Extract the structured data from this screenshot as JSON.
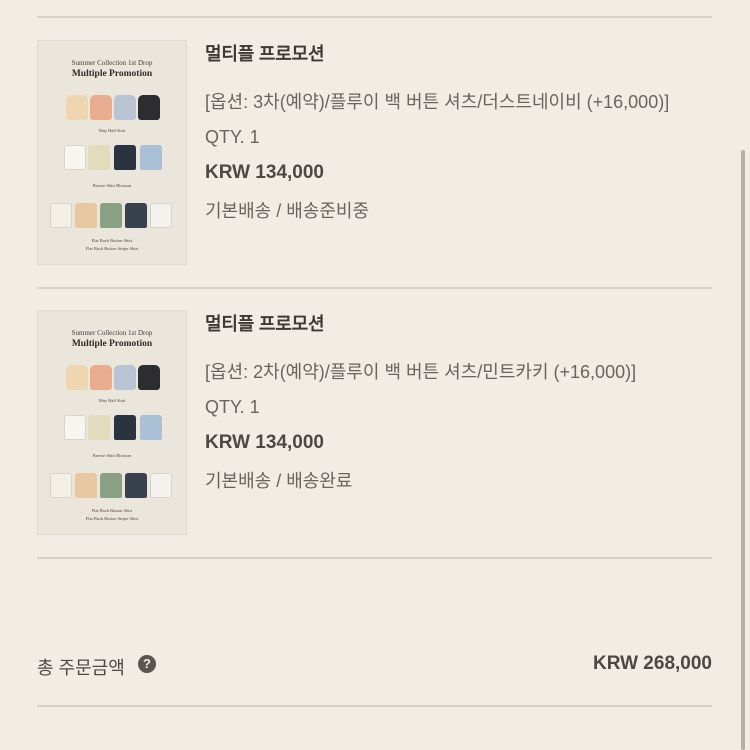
{
  "items": [
    {
      "thumbnail": {
        "subtitle": "Summer Collection 1st Drop",
        "title": "Multiple Promotion",
        "row_labels": [
          "May Half Knit",
          "Breeze Shirt Blouson",
          "Flat Back Button Shirt",
          "Flat Back Button Stripe Shirt"
        ]
      },
      "product_name": "멀티플 프로모션",
      "option": "[옵션: 3차(예약)/플루이 백 버튼 셔츠/더스트네이비 (+16,000)]",
      "qty": "QTY. 1",
      "price": "KRW 134,000",
      "shipping": "기본배송 / 배송준비중"
    },
    {
      "thumbnail": {
        "subtitle": "Summer Collection 1st Drop",
        "title": "Multiple Promotion",
        "row_labels": [
          "May Half Knit",
          "Breeze Shirt Blouson",
          "Flat Back Button Shirt",
          "Flat Back Button Stripe Shirt"
        ]
      },
      "product_name": "멀티플 프로모션",
      "option": "[옵션: 2차(예약)/플루이 백 버튼 셔츠/민트카키 (+16,000)]",
      "qty": "QTY. 1",
      "price": "KRW 134,000",
      "shipping": "기본배송 / 배송완료"
    }
  ],
  "total": {
    "label": "총 주문금액",
    "help_icon": "?",
    "value": "KRW 268,000"
  },
  "colors": {
    "background": "#f1ece4",
    "divider": "#d9d1c6",
    "text_dark": "#3e3935",
    "text_muted": "#6b645e",
    "garments_row1": [
      "#f0d6b0",
      "#e7ad8c",
      "#b8c4d3",
      "#2b2d31"
    ],
    "garments_row2": [
      "#f7f5f0",
      "#e3dcbc",
      "#2c3340",
      "#a9c0d6"
    ],
    "garments_row3": [
      "#f4f0e8",
      "#e8c8a0",
      "#8aa084",
      "#39414f",
      "#f3f1ec"
    ]
  }
}
